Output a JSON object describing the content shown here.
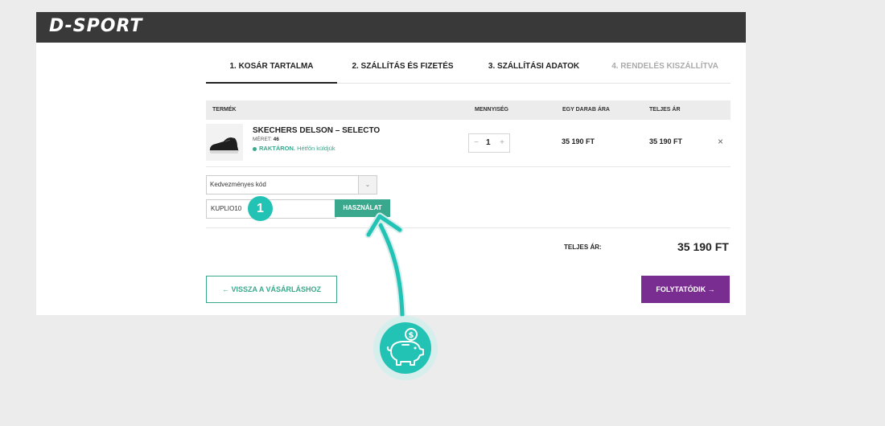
{
  "header": {
    "logo": "D-SPORT"
  },
  "steps": [
    {
      "label": "1. KOSÁR TARTALMA",
      "state": "active"
    },
    {
      "label": "2. SZÁLLÍTÁS ÉS FIZETÉS",
      "state": "normal"
    },
    {
      "label": "3. SZÁLLÍTÁSI ADATOK",
      "state": "normal"
    },
    {
      "label": "4. RENDELÉS KISZÁLLÍTVA",
      "state": "disabled"
    }
  ],
  "table": {
    "headers": {
      "product": "TERMÉK",
      "quantity": "MENNYISÉG",
      "unit_price": "EGY DARAB ÁRA",
      "total": "TELJES ÁR"
    }
  },
  "cart_item": {
    "name": "SKECHERS DELSON – SELECTO",
    "size_label": "MÉRET:",
    "size_value": "46",
    "stock_label": "RAKTÁRON.",
    "stock_note": "Hétfőn küldjük",
    "quantity": "1",
    "qty_minus": "−",
    "qty_plus": "+",
    "unit_price": "35 190 FT",
    "total_price": "35 190 FT",
    "remove_icon": "×"
  },
  "coupon": {
    "select_label": "Kedvezményes kód",
    "caret": "⌄",
    "input_value": "KUPLIO10",
    "apply_label": "HASZNÁLAT"
  },
  "summary": {
    "label": "TELJES ÁR:",
    "value": "35 190 FT"
  },
  "nav": {
    "back_label": "← VISSZA A VÁSÁRLÁSHOZ",
    "continue_label": "FOLYTATÓDIK →"
  },
  "annotation": {
    "badge": "1",
    "icon": "piggy-bank-icon"
  },
  "colors": {
    "accent": "#3aa88c",
    "cta": "#7a2d90",
    "annotation": "#22c2b4",
    "header": "#393939"
  }
}
